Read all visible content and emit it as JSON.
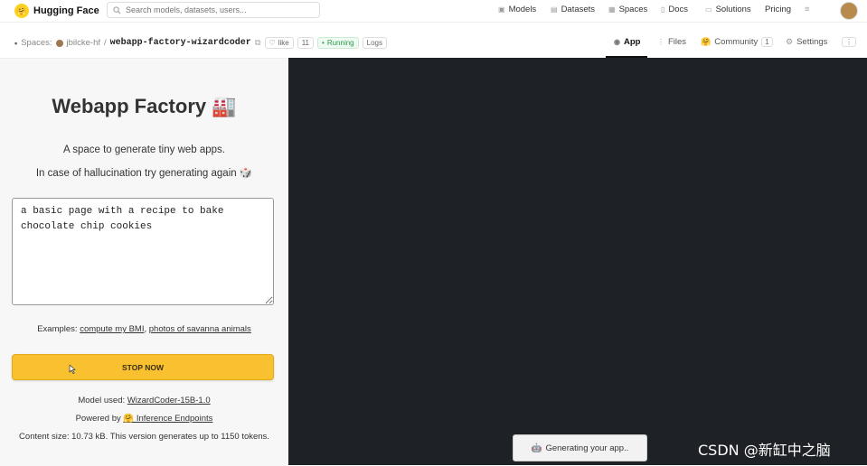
{
  "topbar": {
    "logo_text": "Hugging Face",
    "search_placeholder": "Search models, datasets, users...",
    "nav": [
      {
        "label": "Models",
        "icon": "cube-icon"
      },
      {
        "label": "Datasets",
        "icon": "database-icon"
      },
      {
        "label": "Spaces",
        "icon": "grid-icon"
      },
      {
        "label": "Docs",
        "icon": "doc-icon"
      },
      {
        "label": "Solutions",
        "icon": "briefcase-icon"
      },
      {
        "label": "Pricing",
        "icon": ""
      }
    ],
    "more_label": "≡"
  },
  "space": {
    "spaces_label": "Spaces:",
    "owner": "jbilcke-hf",
    "separator": "/",
    "repo": "webapp-factory-wizardcoder",
    "like_label": "like",
    "like_count": "11",
    "status": "Running",
    "logs_label": "Logs",
    "tabs": [
      {
        "label": "App"
      },
      {
        "label": "Files"
      },
      {
        "label": "Community",
        "badge": "1"
      },
      {
        "label": "Settings"
      }
    ]
  },
  "app": {
    "title": "Webapp Factory 🏭",
    "subtitle": "A space to generate tiny web apps.",
    "hint": "In case of hallucination try generating again 🎲",
    "prompt_value": "a basic page with a recipe to bake chocolate chip cookies",
    "examples_prefix": "Examples:",
    "example_1": "compute my BMI",
    "example_sep": ",",
    "example_2": "photos of savanna animals",
    "stop_button": "STOP NOW",
    "model_prefix": "Model used:",
    "model_link": "WizardCoder-15B-1.0",
    "powered_prefix": "Powered by",
    "powered_link": "🤗 Inference Endpoints",
    "content_size": "Content size: 10.73 kB. This version generates up to 1150 tokens."
  },
  "toast": {
    "text": "Generating your app..",
    "icon": "🤖"
  },
  "watermark": "CSDN @新缸中之脑"
}
